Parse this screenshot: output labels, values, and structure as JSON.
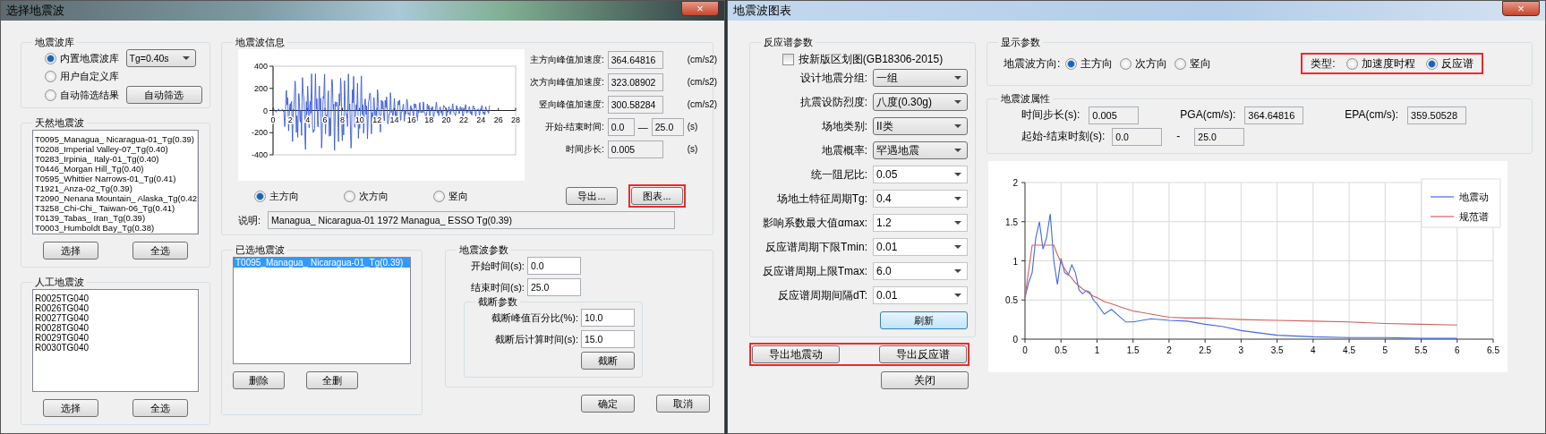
{
  "left_window": {
    "title": "选择地震波",
    "close": "×",
    "library": {
      "title": "地震波库",
      "options": [
        {
          "label": "内置地震波库",
          "selected": true
        },
        {
          "label": "用户自定义库",
          "selected": false
        },
        {
          "label": "自动筛选结果",
          "selected": false
        }
      ],
      "tg_select": "Tg=0.40s",
      "auto_button": "自动筛选"
    },
    "natural": {
      "title": "天然地震波",
      "items": [
        "T0095_Managua_ Nicaragua-01_Tg(0.39)",
        "T0208_Imperial Valley-07_Tg(0.40)",
        "T0283_Irpinia_ Italy-01_Tg(0.40)",
        "T0446_Morgan Hill_Tg(0.40)",
        "T0595_Whittier Narrows-01_Tg(0.41)",
        "T1921_Anza-02_Tg(0.39)",
        "T2090_Nenana Mountain_ Alaska_Tg(0.42",
        "T3258_Chi-Chi_ Taiwan-06_Tg(0.41)",
        "T0139_Tabas_ Iran_Tg(0.39)",
        "T0003_Humboldt Bay_Tg(0.38)"
      ],
      "buttons": [
        "选择",
        "全选"
      ]
    },
    "artificial": {
      "title": "人工地震波",
      "items": [
        "R0025TG040",
        "R0026TG040",
        "R0027TG040",
        "R0028TG040",
        "R0029TG040",
        "R0030TG040"
      ],
      "buttons": [
        "选择",
        "全选"
      ]
    },
    "info": {
      "title": "地震波信息",
      "waveform": {
        "yticks": [
          "400",
          "200",
          "0",
          "-200",
          "-400"
        ],
        "xticks": [
          "0",
          "2",
          "4",
          "6",
          "8",
          "10",
          "12",
          "14",
          "16",
          "18",
          "20",
          "22",
          "24",
          "26",
          "28"
        ]
      },
      "fields": [
        {
          "label": "主方向峰值加速度:",
          "value": "364.64816",
          "unit": "(cm/s2)"
        },
        {
          "label": "次方向峰值加速度:",
          "value": "323.08902",
          "unit": "(cm/s2)"
        },
        {
          "label": "竖向峰值加速度:",
          "value": "300.58284",
          "unit": "(cm/s2)"
        },
        {
          "label": "开始-结束时间:",
          "value": "0.0",
          "separator": "—",
          "value_2": "25.0",
          "unit": "(s)"
        },
        {
          "label": "时间步长:",
          "value": "0.005",
          "unit": "(s)"
        }
      ],
      "directions": [
        {
          "label": "主方向",
          "selected": true
        },
        {
          "label": "次方向",
          "selected": false
        },
        {
          "label": "竖向",
          "selected": false
        }
      ],
      "buttons": [
        {
          "label": "导出...",
          "highlighted": false
        },
        {
          "label": "图表...",
          "highlighted": true
        }
      ],
      "note_label": "说明:",
      "note": "Managua_ Nicaragua-01 1972 Managua_ ESSO Tg(0.39)"
    },
    "selected": {
      "title": "已选地震波",
      "items": [
        {
          "label": "T0095_Managua_ Nicaragua-01_Tg(0.39)",
          "selected": true
        }
      ],
      "buttons": [
        "删除",
        "全删"
      ]
    },
    "params": {
      "title": "地震波参数",
      "fields": [
        {
          "label": "开始时间(s):",
          "value": "0.0"
        },
        {
          "label": "结束时间(s):",
          "value": "25.0"
        }
      ],
      "truncation": {
        "title": "截断参数",
        "fields": [
          {
            "label": "截断峰值百分比(%):",
            "value": "10.0"
          },
          {
            "label": "截断后计算时间(s):",
            "value": "15.0"
          }
        ],
        "button": "截断"
      }
    },
    "footer_buttons": [
      "确定",
      "取消"
    ]
  },
  "right_window": {
    "title": "地震波图表",
    "close": "×",
    "spectrum_params": {
      "title": "反应谱参数",
      "new_zoning": {
        "label": "按新版区划图(GB18306-2015)",
        "checked": false
      },
      "rows": [
        {
          "label": "设计地震分组:",
          "value": "一组",
          "kind": "list"
        },
        {
          "label": "抗震设防烈度:",
          "value": "八度(0.30g)",
          "kind": "list"
        },
        {
          "label": "场地类别:",
          "value": "II类",
          "kind": "list"
        },
        {
          "label": "地震概率:",
          "value": "罕遇地震",
          "kind": "list"
        },
        {
          "label": "统一阻尼比:",
          "value": "0.05",
          "kind": "combo"
        },
        {
          "label": "场地土特征周期Tg:",
          "value": "0.4",
          "kind": "combo"
        },
        {
          "label": "影响系数最大值αmax:",
          "value": "1.2",
          "kind": "combo"
        },
        {
          "label": "反应谱周期下限Tmin:",
          "value": "0.01",
          "kind": "combo"
        },
        {
          "label": "反应谱周期上限Tmax:",
          "value": "6.0",
          "kind": "combo"
        },
        {
          "label": "反应谱周期间隔dT:",
          "value": "0.01",
          "kind": "combo"
        }
      ],
      "refresh_button": "刷新"
    },
    "export": {
      "highlighted": true,
      "buttons": [
        "导出地震动",
        "导出反应谱"
      ]
    },
    "close_button": "关闭",
    "display": {
      "title": "显示参数",
      "direction_label": "地震波方向:",
      "directions": [
        {
          "label": "主方向",
          "selected": true
        },
        {
          "label": "次方向",
          "selected": false
        },
        {
          "label": "竖向",
          "selected": false
        }
      ],
      "type": {
        "label": "类型:",
        "highlighted": true,
        "options": [
          {
            "label": "加速度时程",
            "selected": false
          },
          {
            "label": "反应谱",
            "selected": true
          }
        ]
      }
    },
    "props": {
      "title": "地震波属性",
      "fields": [
        {
          "label": "时间步长(s):",
          "value": "0.005"
        },
        {
          "label": "PGA(cm/s):",
          "value": "364.64816"
        },
        {
          "label": "EPA(cm/s):",
          "value": "359.50528"
        }
      ],
      "range": {
        "label": "起始-结束时刻(s):",
        "start": "0.0",
        "separator": "-",
        "end": "25.0"
      }
    },
    "chart_data": {
      "type": "line",
      "x": [
        0,
        0.05,
        0.1,
        0.15,
        0.2,
        0.25,
        0.3,
        0.35,
        0.4,
        0.45,
        0.5,
        0.55,
        0.6,
        0.65,
        0.7,
        0.75,
        0.8,
        0.85,
        0.9,
        0.95,
        1.0,
        1.1,
        1.2,
        1.3,
        1.4,
        1.5,
        1.75,
        2.0,
        2.25,
        2.5,
        2.75,
        3.0,
        3.5,
        4.0,
        4.5,
        5.0,
        5.5,
        6.0
      ],
      "series": [
        {
          "name": "地震动",
          "color": "#4169e1",
          "values": [
            0.53,
            0.72,
            0.85,
            1.3,
            1.5,
            1.15,
            1.3,
            1.6,
            1.0,
            0.7,
            1.03,
            0.85,
            0.82,
            0.95,
            0.85,
            0.63,
            0.58,
            0.62,
            0.6,
            0.5,
            0.45,
            0.32,
            0.38,
            0.3,
            0.22,
            0.22,
            0.26,
            0.24,
            0.23,
            0.19,
            0.16,
            0.11,
            0.05,
            0.03,
            0.02,
            0.02,
            0.01,
            0.01
          ]
        },
        {
          "name": "规范谱",
          "color": "#d06060",
          "values": [
            0.54,
            0.87,
            1.2,
            1.2,
            1.2,
            1.2,
            1.2,
            1.2,
            1.2,
            1.08,
            0.98,
            0.9,
            0.83,
            0.78,
            0.72,
            0.68,
            0.64,
            0.61,
            0.58,
            0.55,
            0.53,
            0.48,
            0.45,
            0.42,
            0.39,
            0.36,
            0.32,
            0.28,
            0.27,
            0.27,
            0.26,
            0.25,
            0.24,
            0.23,
            0.22,
            0.2,
            0.19,
            0.18
          ]
        }
      ],
      "grid": true,
      "legend": true,
      "xlim": [
        0,
        6.5
      ],
      "ylim": [
        0,
        2
      ],
      "xticks": [
        {
          "value": 0,
          "label": "0"
        },
        {
          "value": 0.5,
          "label": "0.5"
        },
        {
          "value": 1,
          "label": "1"
        },
        {
          "value": 1.5,
          "label": "1.5"
        },
        {
          "value": 2,
          "label": "2"
        },
        {
          "value": 2.5,
          "label": "2.5"
        },
        {
          "value": 3,
          "label": "3"
        },
        {
          "value": 3.5,
          "label": "3.5"
        },
        {
          "value": 4,
          "label": "4"
        },
        {
          "value": 4.5,
          "label": "4.5"
        },
        {
          "value": 5,
          "label": "5"
        },
        {
          "value": 5.5,
          "label": "5.5"
        },
        {
          "value": 6,
          "label": "6"
        },
        {
          "value": 6.5,
          "label": "6.5"
        }
      ],
      "yticks": [
        {
          "value": 0,
          "label": "0"
        },
        {
          "value": 0.5,
          "label": "0.5"
        },
        {
          "value": 1,
          "label": "1"
        },
        {
          "value": 1.5,
          "label": "1.5"
        },
        {
          "value": 2,
          "label": "2"
        }
      ]
    }
  }
}
